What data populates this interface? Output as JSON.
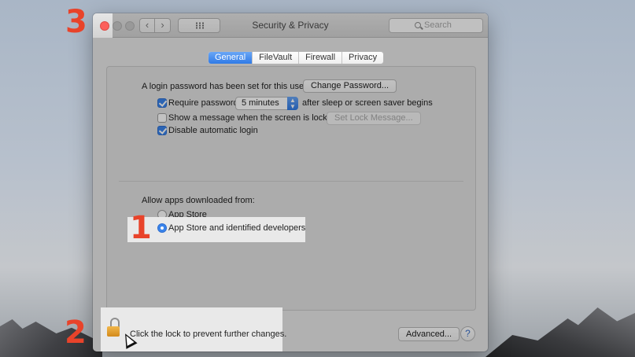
{
  "window": {
    "title": "Security & Privacy",
    "search_placeholder": "Search"
  },
  "tabs": [
    {
      "label": "General",
      "active": true
    },
    {
      "label": "FileVault",
      "active": false
    },
    {
      "label": "Firewall",
      "active": false
    },
    {
      "label": "Privacy",
      "active": false
    }
  ],
  "general": {
    "login_password_text": "A login password has been set for this user",
    "change_password_label": "Change Password...",
    "require_password_label": "Require password",
    "require_password_checked": true,
    "require_password_value": "5 minutes",
    "after_sleep_text": "after sleep or screen saver begins",
    "show_message_label": "Show a message when the screen is locked",
    "show_message_checked": false,
    "set_lock_message_label": "Set Lock Message...",
    "disable_auto_login_label": "Disable automatic login",
    "disable_auto_login_checked": true,
    "allow_apps_label": "Allow apps downloaded from:",
    "option_app_store": "App Store",
    "option_identified": "App Store and identified developers",
    "selected_option": "App Store and identified developers"
  },
  "footer": {
    "lock_text": "Click the lock to prevent further changes.",
    "advanced_label": "Advanced...",
    "help_label": "?"
  },
  "steps": [
    "1",
    "2",
    "3"
  ],
  "colors": {
    "accent": "#3a84eb",
    "step_marker": "#e8432a",
    "close_button": "#fc605b"
  }
}
